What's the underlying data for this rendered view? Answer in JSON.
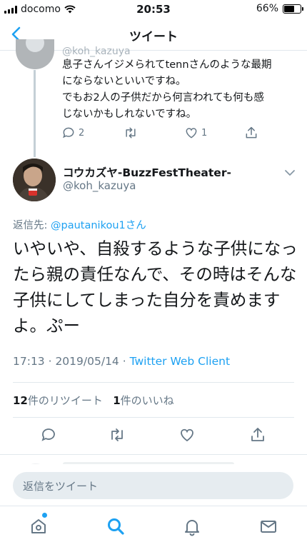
{
  "status_bar": {
    "carrier": "docomo",
    "time": "20:53",
    "battery": "66%",
    "battery_level": 0.66
  },
  "nav": {
    "title": "ツイート"
  },
  "previous_tweet": {
    "handle": "@koh_kazuya",
    "text_lines": [
      "息子さんイジメられてtennさんのような最期",
      "にならないといいですね。",
      "でもお2人の子供だから何言われても何も感",
      "じないかもしれないですね。"
    ],
    "reply_count": "2",
    "like_count": "1"
  },
  "tweet": {
    "display_name": "コウカズヤ-BuzzFestTheater-",
    "handle": "@koh_kazuya",
    "reply_to_prefix": "返信先: ",
    "reply_to_mention": "@pautanikou1さん",
    "body": "いやいや、自殺するような子供になったら親の責任なんで、その時はそんな子供にしてしまった自分を責めますよ。ぷー",
    "timestamp": "17:13 · 2019/05/14 · ",
    "client": "Twitter Web Client",
    "retweet_count": "12",
    "retweet_label": "件のリツイート",
    "like_count": "1",
    "like_label": "件のいいね"
  },
  "reply_bar": {
    "placeholder": "返信をツイート"
  },
  "colors": {
    "accent": "#1da1f2",
    "secondary_text": "#657786",
    "text": "#14171a",
    "border": "#e1e8ed"
  },
  "icons": [
    "back-icon",
    "reply-icon",
    "retweet-icon",
    "like-icon",
    "share-icon",
    "chevron-down-icon",
    "home-icon",
    "search-icon",
    "bell-icon",
    "mail-icon"
  ]
}
